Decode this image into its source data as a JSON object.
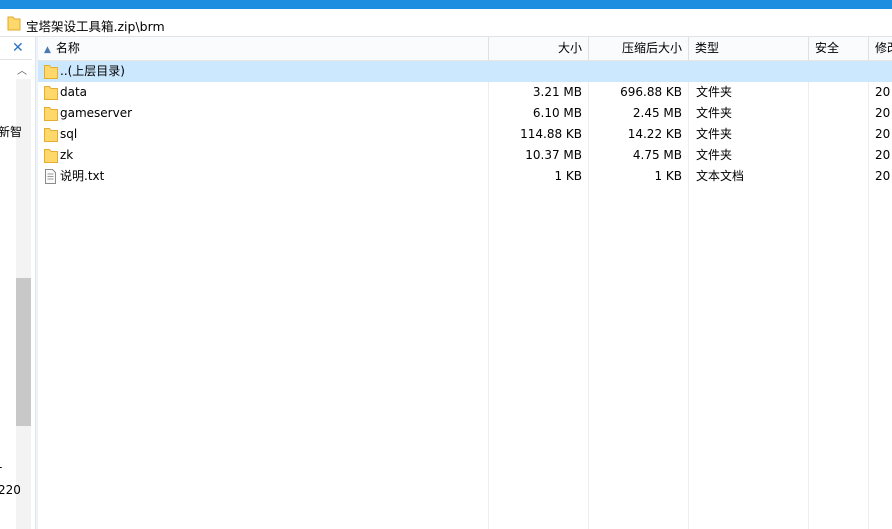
{
  "address": {
    "path": "宝塔架设工具箱.zip\\brm"
  },
  "left_pane": {
    "clipped_text_1": "新智",
    "clipped_text_2": "-",
    "clipped_text_3": "220"
  },
  "columns": [
    {
      "key": "name",
      "label": "名称"
    },
    {
      "key": "size",
      "label": "大小"
    },
    {
      "key": "packed",
      "label": "压缩后大小"
    },
    {
      "key": "type",
      "label": "类型"
    },
    {
      "key": "security",
      "label": "安全"
    },
    {
      "key": "modified",
      "label": "修改"
    }
  ],
  "rows": [
    {
      "icon": "folder-icon",
      "name": "..(上层目录)",
      "size": "",
      "packed": "",
      "type": "",
      "security": "",
      "modified": ""
    },
    {
      "icon": "folder-icon",
      "name": "data",
      "size": "3.21 MB",
      "packed": "696.88 KB",
      "type": "文件夹",
      "security": "",
      "modified": "20"
    },
    {
      "icon": "folder-icon",
      "name": "gameserver",
      "size": "6.10 MB",
      "packed": "2.45 MB",
      "type": "文件夹",
      "security": "",
      "modified": "20"
    },
    {
      "icon": "folder-icon",
      "name": "sql",
      "size": "114.88 KB",
      "packed": "14.22 KB",
      "type": "文件夹",
      "security": "",
      "modified": "20"
    },
    {
      "icon": "folder-icon",
      "name": "zk",
      "size": "10.37 MB",
      "packed": "4.75 MB",
      "type": "文件夹",
      "security": "",
      "modified": "20"
    },
    {
      "icon": "text-file-icon",
      "name": "说明.txt",
      "size": "1 KB",
      "packed": "1 KB",
      "type": "文本文档",
      "security": "",
      "modified": "20"
    }
  ],
  "colors": {
    "title_bar": "#1e8ee0",
    "selected_row": "#cce8ff",
    "folder_yellow": "#ffd86b"
  }
}
